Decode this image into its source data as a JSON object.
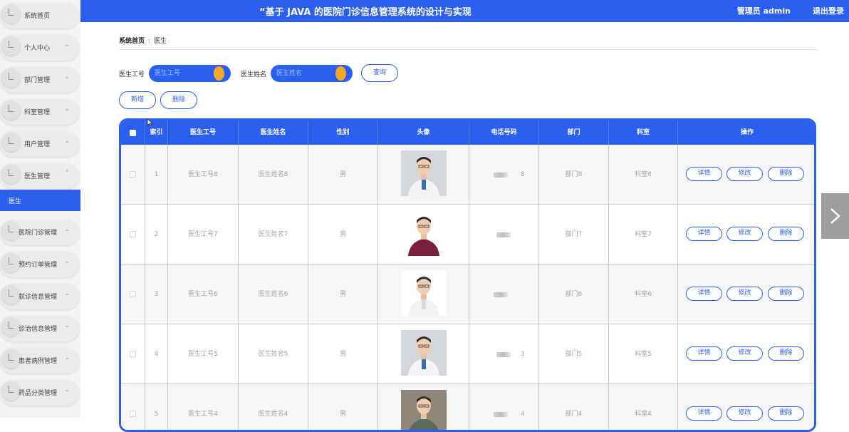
{
  "header": {
    "title": "“基于 JAVA 的医院门诊信息管理系统的设计与实现",
    "admin": "管理员 admin",
    "logout": "退出登录"
  },
  "sidebar": {
    "items": [
      {
        "label": "系统首页",
        "chevron": ""
      },
      {
        "label": "个人中心",
        "chevron": "⌄"
      },
      {
        "label": "部门管理",
        "chevron": "⌄"
      },
      {
        "label": "科室管理",
        "chevron": "⌄"
      },
      {
        "label": "用户管理",
        "chevron": "⌄"
      },
      {
        "label": "医生管理",
        "chevron": "⌃"
      },
      {
        "label": "医院门诊管理",
        "chevron": "⌄"
      },
      {
        "label": "预约订单管理",
        "chevron": "⌄"
      },
      {
        "label": "就诊信息管理",
        "chevron": "⌄"
      },
      {
        "label": "诊治信息管理",
        "chevron": "⌄"
      },
      {
        "label": "患者病例管理",
        "chevron": "⌄"
      },
      {
        "label": "药品分类管理",
        "chevron": "⌄"
      }
    ],
    "active_sub": "医生"
  },
  "breadcrumb": {
    "home": "系统首页",
    "separator": ":",
    "current": "医生"
  },
  "search": {
    "doctor_id_label": "医生工号",
    "doctor_id_placeholder": "医生工号",
    "doctor_name_label": "医生姓名",
    "doctor_name_placeholder": "医生姓名",
    "query_button": "查询"
  },
  "actions": {
    "add": "新增",
    "delete": "删除"
  },
  "table": {
    "headers": [
      "索引",
      "医生工号",
      "医生姓名",
      "性别",
      "头像",
      "电话号码",
      "部门",
      "科室",
      "操作"
    ],
    "row_buttons": {
      "detail": "详情",
      "edit": "修改",
      "delete": "删除"
    },
    "rows": [
      {
        "index": "1",
        "id": "医生工号8",
        "name": "医生姓名8",
        "gender": "男",
        "phone_tail": "8",
        "dept": "部门8",
        "office": "科室8"
      },
      {
        "index": "2",
        "id": "医生工号7",
        "name": "医生姓名7",
        "gender": "男",
        "phone_tail": "",
        "dept": "部门7",
        "office": "科室7"
      },
      {
        "index": "3",
        "id": "医生工号6",
        "name": "医生姓名6",
        "gender": "男",
        "phone_tail": "",
        "dept": "部门6",
        "office": "科室6"
      },
      {
        "index": "4",
        "id": "医生工号5",
        "name": "医生姓名5",
        "gender": "男",
        "phone_tail": "3",
        "dept": "部门5",
        "office": "科室5"
      },
      {
        "index": "5",
        "id": "医生工号4",
        "name": "医生姓名4",
        "gender": "男",
        "phone_tail": "4",
        "dept": "部门4",
        "office": "科室4"
      }
    ]
  },
  "colors": {
    "primary": "#2a5ff0",
    "accent": "#f5a623"
  }
}
